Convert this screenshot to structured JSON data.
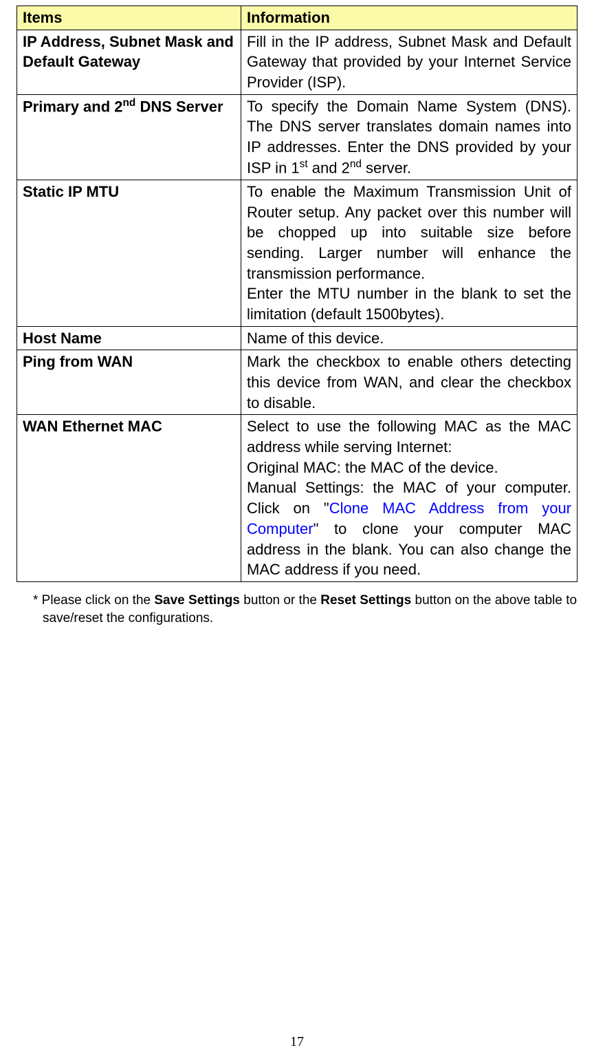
{
  "table": {
    "headers": {
      "items": "Items",
      "information": "Information"
    },
    "rows": [
      {
        "item": "IP Address, Subnet Mask and Default Gateway",
        "info": "Fill in the IP address, Subnet Mask and Default Gateway that provided by your Internet Service Provider (ISP)."
      },
      {
        "item_pre": "Primary and 2",
        "item_sup": "nd",
        "item_post": " DNS Server",
        "info_pre": "To specify the Domain Name System (DNS). The DNS server translates domain names into IP addresses. Enter the DNS provided by your ISP in 1",
        "info_sup1": "st",
        "info_mid": " and 2",
        "info_sup2": "nd",
        "info_post": " server."
      },
      {
        "item": "Static IP MTU",
        "info_l1": "To enable the Maximum Transmission Unit of Router setup. Any packet over this number will be chopped up into suitable size before sending. Larger number will enhance the transmission performance.",
        "info_l2": "Enter the MTU number in the blank to set the limitation (default 1500bytes)."
      },
      {
        "item": "Host Name",
        "info": "Name of this device."
      },
      {
        "item": "Ping from WAN",
        "info": "Mark the checkbox to enable others detecting this device from WAN, and clear the checkbox to disable."
      },
      {
        "item": "WAN Ethernet MAC",
        "info_l1": "Select to use the following MAC as the MAC address while serving Internet:",
        "info_l2": "Original MAC: the MAC of the device.",
        "info_l3_pre": "Manual Settings: the MAC of your computer. Click on \"",
        "info_l3_link": "Clone MAC Address from your Computer",
        "info_l3_post": "\" to clone your computer MAC address in the blank. You can also change the MAC address if you need."
      }
    ]
  },
  "footnote": {
    "pre": "* Please click on the ",
    "b1": "Save Settings",
    "mid": " button or the ",
    "b2": "Reset Settings",
    "post": " button on the above table to save/reset the configurations."
  },
  "page_number": "17"
}
